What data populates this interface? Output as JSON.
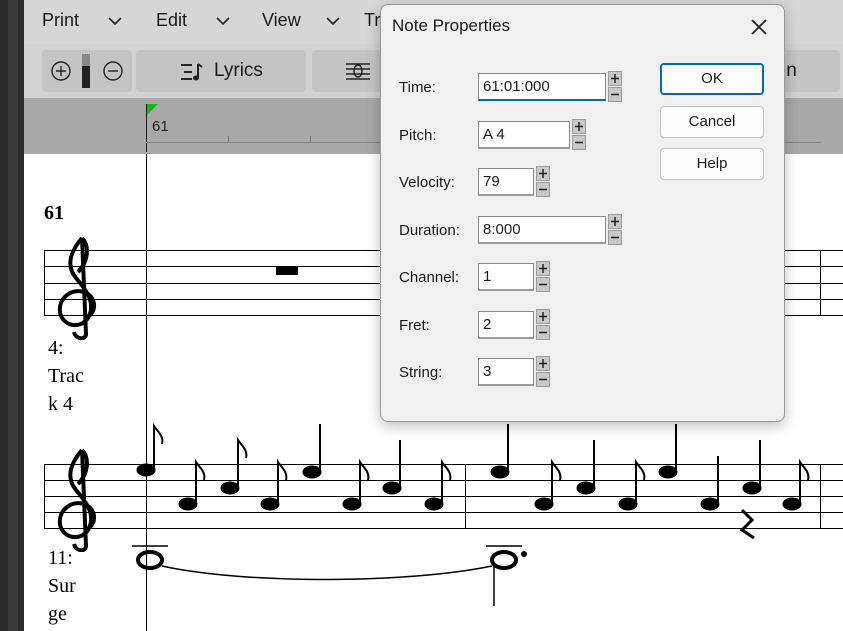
{
  "menubar": {
    "items": [
      "Print",
      "Edit",
      "View",
      "Tr"
    ]
  },
  "toolbar": {
    "lyrics_label": "Lyrics",
    "right_label": "in"
  },
  "ruler": {
    "measure_label": "61"
  },
  "score": {
    "measure_number": "61",
    "track4_name": [
      "4:",
      "Trac",
      "k 4"
    ],
    "track11_name": [
      "11:",
      "Sur",
      "ge"
    ]
  },
  "dialog": {
    "title": "Note Properties",
    "fields": [
      {
        "label": "Time:",
        "value": "61:01:000"
      },
      {
        "label": "Pitch:",
        "value": "A 4"
      },
      {
        "label": "Velocity:",
        "value": "79"
      },
      {
        "label": "Duration:",
        "value": "8:000"
      },
      {
        "label": "Channel:",
        "value": "1"
      },
      {
        "label": "Fret:",
        "value": "2"
      },
      {
        "label": "String:",
        "value": "3"
      }
    ],
    "buttons": {
      "ok": "OK",
      "cancel": "Cancel",
      "help": "Help"
    }
  }
}
